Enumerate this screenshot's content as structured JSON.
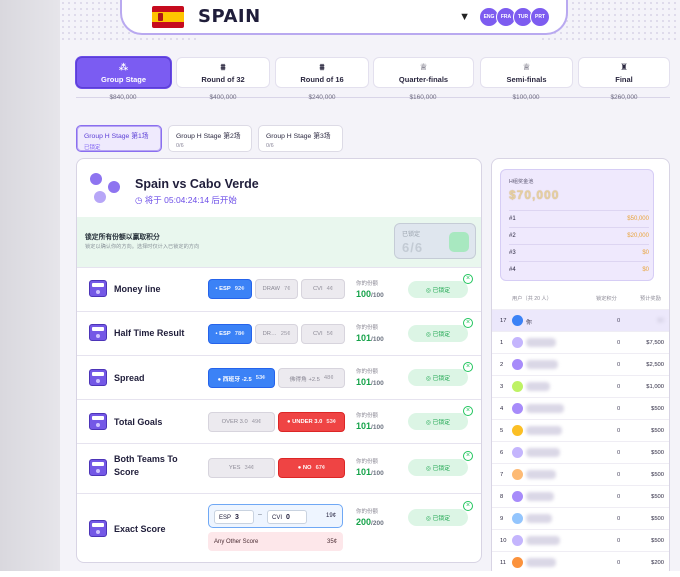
{
  "team": {
    "name": "SPAIN",
    "chips": [
      "ENG",
      "FRA",
      "TUR",
      "PRT"
    ]
  },
  "stages": [
    {
      "label": "Group Stage",
      "prize": "$840,000",
      "active": true
    },
    {
      "label": "Round of 32",
      "prize": "$400,000"
    },
    {
      "label": "Round of 16",
      "prize": "$240,000"
    },
    {
      "label": "Quarter-finals",
      "prize": "$160,000"
    },
    {
      "label": "Semi-finals",
      "prize": "$100,000"
    },
    {
      "label": "Final",
      "prize": "$260,000"
    }
  ],
  "match_tabs": [
    {
      "label": "Group H Stage 第1场",
      "sub": "已锁定",
      "active": true
    },
    {
      "label": "Group H Stage 第2场",
      "sub": "0/6"
    },
    {
      "label": "Group H Stage 第3场",
      "sub": "0/6"
    }
  ],
  "match": {
    "title": "Spain vs Cabo Verde",
    "countdown": "◷ 将于 05:04:24:14 后开始",
    "lock_title": "锁定所有份额以赢取积分",
    "lock_sub": "锁定以确认你的方向。选择时仅计入已锁定的方向",
    "locked_label": "已锁定",
    "locked_count": "6/6"
  },
  "markets": [
    {
      "name": "Money line",
      "options": [
        {
          "label": "• ESP",
          "price": "92¢",
          "state": "blue"
        },
        {
          "label": "DRAW",
          "price": "7¢"
        },
        {
          "label": "CVI",
          "price": "4¢"
        }
      ],
      "share_label": "你的份额",
      "share": "100",
      "share_total": "/100",
      "locked": "◎ 已锁定"
    },
    {
      "name": "Half Time Result",
      "options": [
        {
          "label": "• ESP",
          "price": "78¢",
          "state": "blue"
        },
        {
          "label": "DR…",
          "price": "25¢"
        },
        {
          "label": "CVI",
          "price": "5¢"
        }
      ],
      "share_label": "你的份额",
      "share": "101",
      "share_total": "/100",
      "locked": "◎ 已锁定"
    },
    {
      "name": "Spread",
      "options": [
        {
          "label": "● 西班牙 -2.5",
          "price": "53¢",
          "state": "blue"
        },
        {
          "label": "佛得角 +2.5",
          "price": "48¢"
        }
      ],
      "share_label": "你的份额",
      "share": "101",
      "share_total": "/100",
      "locked": "◎ 已锁定"
    },
    {
      "name": "Total Goals",
      "options": [
        {
          "label": "OVER 3.0",
          "price": "49¢"
        },
        {
          "label": "● UNDER 3.0",
          "price": "53¢",
          "state": "red"
        }
      ],
      "share_label": "你的份额",
      "share": "101",
      "share_total": "/100",
      "locked": "◎ 已锁定"
    },
    {
      "name": "Both Teams To Score",
      "options": [
        {
          "label": "YES",
          "price": "34¢"
        },
        {
          "label": "● NO",
          "price": "67¢",
          "state": "red"
        }
      ],
      "share_label": "你的份额",
      "share": "101",
      "share_total": "/100",
      "locked": "◎ 已锁定"
    },
    {
      "name": "Exact Score",
      "score": {
        "home_label": "ESP",
        "home_value": "3",
        "sep": "–",
        "away_label": "CVI",
        "away_value": "0",
        "price": "19¢"
      },
      "other": {
        "label": "Any Other Score",
        "price": "35¢"
      },
      "share_label": "你的份额",
      "share": "200",
      "share_total": "/200",
      "locked": "◎ 已锁定"
    }
  ],
  "pool": {
    "label": "H组奖金池",
    "amount": "$70,000",
    "rows": [
      {
        "rank": "#1",
        "value": "$50,000"
      },
      {
        "rank": "#2",
        "value": "$20,000"
      },
      {
        "rank": "#3",
        "value": "$0"
      },
      {
        "rank": "#4",
        "value": "$0"
      }
    ]
  },
  "leaderboard": {
    "headers": {
      "user": "用户（共 20 人）",
      "score": "锁定积分",
      "prize": "预计奖励"
    },
    "rows": [
      {
        "rank": "17",
        "name": "你",
        "score": "0",
        "prize": "$0",
        "me": true,
        "color": "#3b82f6"
      },
      {
        "rank": "1",
        "score": "0",
        "prize": "$7,500",
        "color": "#c4b5fd"
      },
      {
        "rank": "2",
        "score": "0",
        "prize": "$2,500",
        "color": "#a78bfa"
      },
      {
        "rank": "3",
        "score": "0",
        "prize": "$1,000",
        "color": "#bef264"
      },
      {
        "rank": "4",
        "score": "0",
        "prize": "$500",
        "color": "#a78bfa"
      },
      {
        "rank": "5",
        "score": "0",
        "prize": "$500",
        "color": "#fbbf24"
      },
      {
        "rank": "6",
        "score": "0",
        "prize": "$500",
        "color": "#c4b5fd"
      },
      {
        "rank": "7",
        "score": "0",
        "prize": "$500",
        "color": "#fdba74"
      },
      {
        "rank": "8",
        "score": "0",
        "prize": "$500",
        "color": "#a78bfa"
      },
      {
        "rank": "9",
        "score": "0",
        "prize": "$500",
        "color": "#93c5fd"
      },
      {
        "rank": "10",
        "score": "0",
        "prize": "$500",
        "color": "#c4b5fd"
      },
      {
        "rank": "11",
        "score": "0",
        "prize": "$200",
        "color": "#fb923c"
      }
    ]
  }
}
